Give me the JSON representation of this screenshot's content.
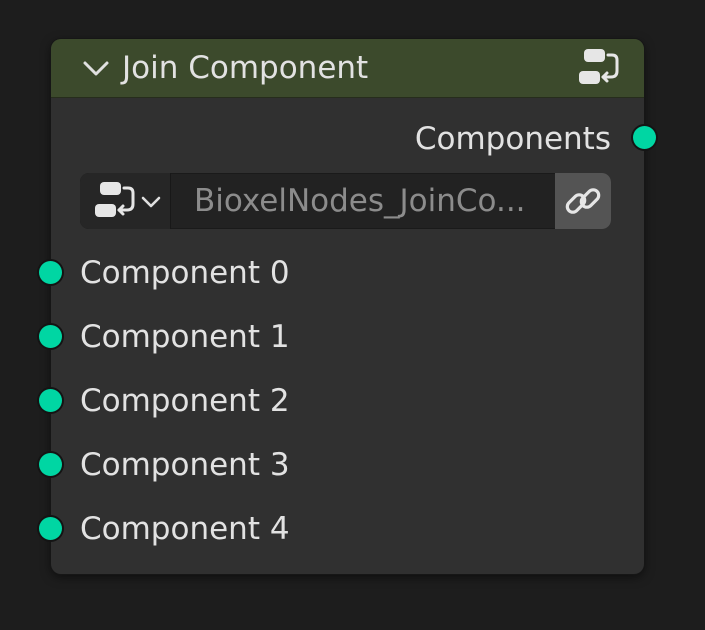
{
  "node": {
    "title": "Join Component",
    "header_color": "#3c4a2c",
    "body_color": "#303030",
    "collapse_icon": "chevron-down-icon",
    "type_icon": "node-group-icon"
  },
  "outputs": [
    {
      "label": "Components",
      "socket_color": "#00d6a3"
    }
  ],
  "group_selector": {
    "browse_icon": "node-group-icon",
    "dropdown_icon": "chevron-down-icon",
    "value": "BioxelNodes_JoinCo...",
    "link_icon": "link-icon"
  },
  "inputs": [
    {
      "label": "Component 0",
      "socket_color": "#00d6a3"
    },
    {
      "label": "Component 1",
      "socket_color": "#00d6a3"
    },
    {
      "label": "Component 2",
      "socket_color": "#00d6a3"
    },
    {
      "label": "Component 3",
      "socket_color": "#00d6a3"
    },
    {
      "label": "Component 4",
      "socket_color": "#00d6a3"
    }
  ]
}
